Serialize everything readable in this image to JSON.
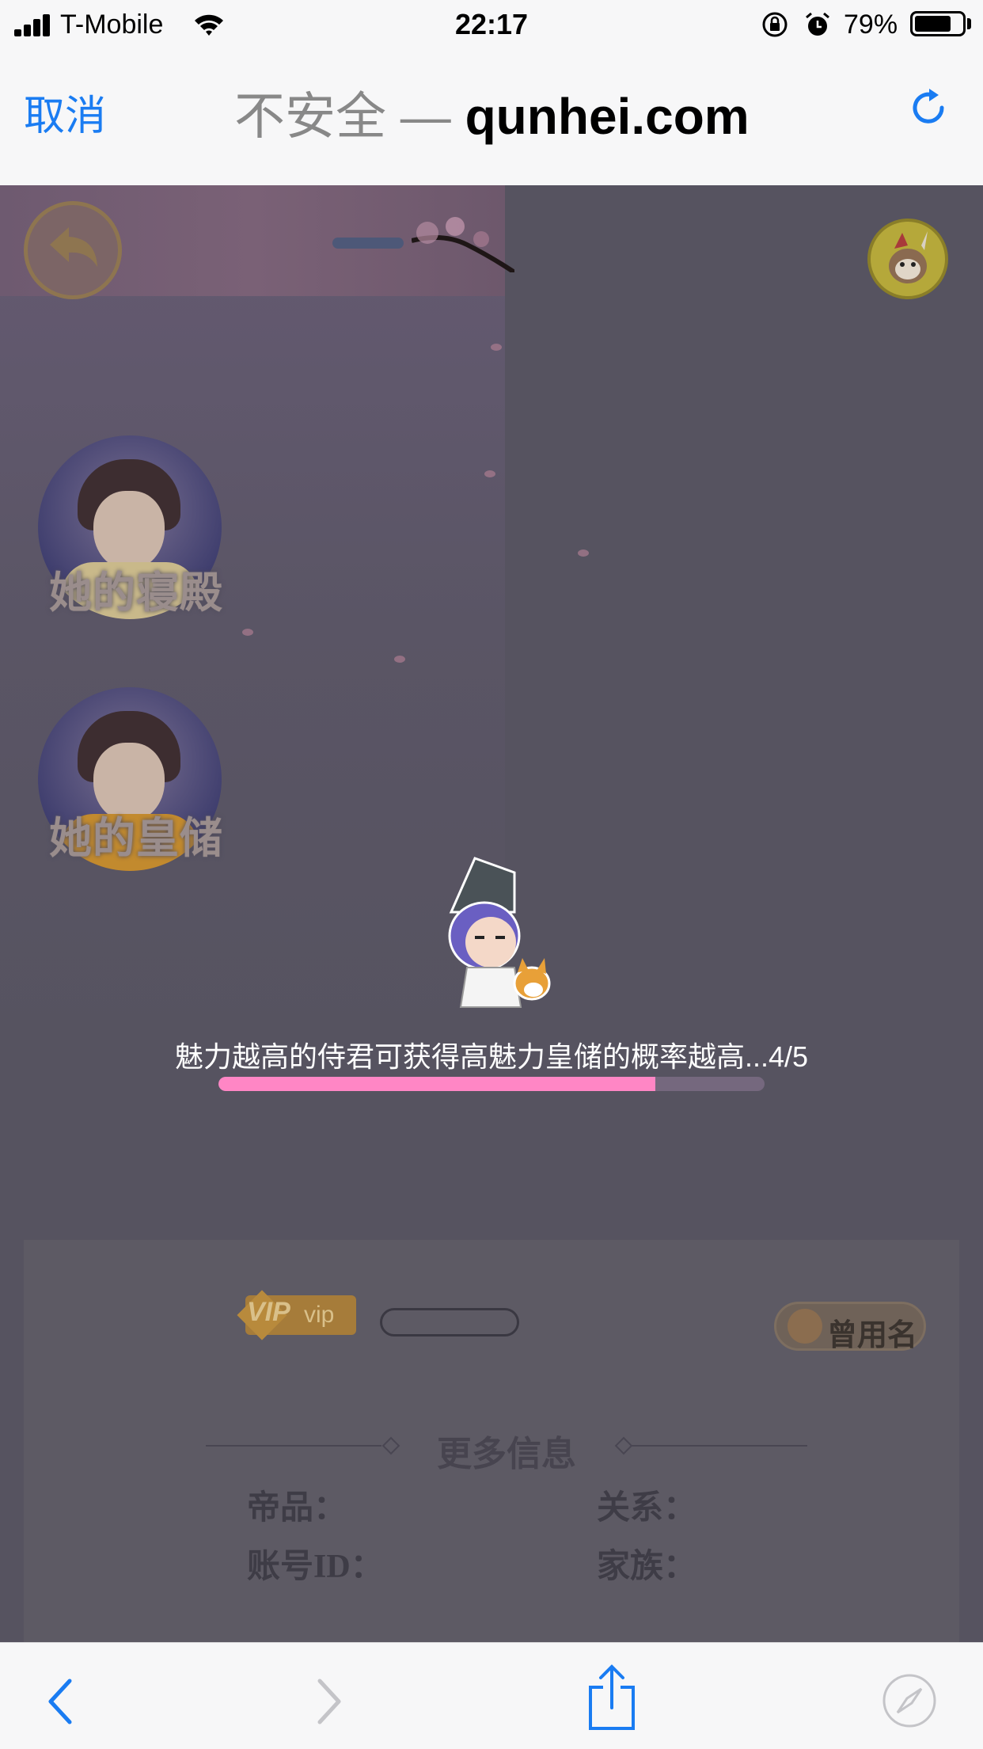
{
  "status_bar": {
    "carrier": "T-Mobile",
    "time": "22:17",
    "battery_percent": "79%",
    "battery_level": 0.79
  },
  "browser": {
    "cancel_label": "取消",
    "url_prefix": "不安全 — ",
    "url_host": "qunhei.com"
  },
  "game": {
    "portraits": [
      {
        "label": "她的寝殿",
        "robe_color": "#c9b98a"
      },
      {
        "label": "她的皇储",
        "robe_color": "#c28a2e"
      }
    ],
    "loading": {
      "tip_text": "魅力越高的侍君可获得高魅力皇储的概率越高...4/5",
      "progress": 0.8,
      "progress_color": "#ff86c5"
    },
    "info_panel": {
      "vip_label": "VIP",
      "vip_small": "vip",
      "former_name_label": "曾用名",
      "more_info_title": "更多信息",
      "fields": {
        "rank_label": "帝品：",
        "relation_label": "关系：",
        "account_label": "账号ID：",
        "family_label": "家族："
      }
    }
  },
  "colors": {
    "accent": "#1a7cf2",
    "overlay": "#565360"
  }
}
